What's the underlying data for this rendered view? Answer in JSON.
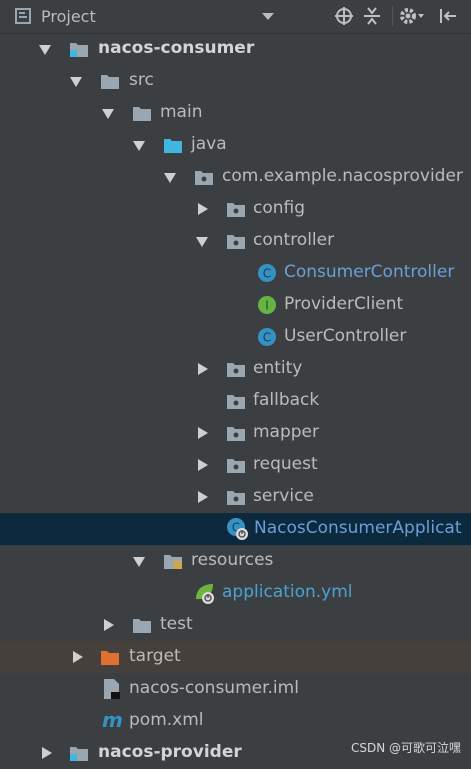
{
  "header": {
    "title": "Project",
    "icons": [
      "project-view-icon",
      "dropdown-caret-icon",
      "crosshair-locate-icon",
      "collapse-all-icon",
      "gear-icon",
      "hide-panel-icon"
    ]
  },
  "tree": [
    {
      "label": "nacos-consumer",
      "icon": "module-folder-icon",
      "expanded": true
    },
    {
      "label": "src",
      "icon": "folder-icon",
      "expanded": true
    },
    {
      "label": "main",
      "icon": "folder-icon",
      "expanded": true
    },
    {
      "label": "java",
      "icon": "source-folder-icon",
      "expanded": true
    },
    {
      "label": "com.example.nacosprovider",
      "icon": "package-icon",
      "expanded": true
    },
    {
      "label": "config",
      "icon": "package-icon",
      "expanded": false
    },
    {
      "label": "controller",
      "icon": "package-icon",
      "expanded": true
    },
    {
      "label": "ConsumerController",
      "icon": "class-icon",
      "letter": "C"
    },
    {
      "label": "ProviderClient",
      "icon": "interface-icon",
      "letter": "I"
    },
    {
      "label": "UserController",
      "icon": "class-icon",
      "letter": "C"
    },
    {
      "label": "entity",
      "icon": "package-icon",
      "expanded": false
    },
    {
      "label": "fallback",
      "icon": "package-icon"
    },
    {
      "label": "mapper",
      "icon": "package-icon",
      "expanded": false
    },
    {
      "label": "request",
      "icon": "package-icon",
      "expanded": false
    },
    {
      "label": "service",
      "icon": "package-icon",
      "expanded": false
    },
    {
      "label": "NacosConsumerApplicat",
      "icon": "spring-boot-class-icon",
      "letter": "C",
      "selected": true
    },
    {
      "label": "resources",
      "icon": "resources-folder-icon",
      "expanded": true
    },
    {
      "label": "application.yml",
      "icon": "spring-config-icon"
    },
    {
      "label": "test",
      "icon": "folder-icon",
      "expanded": false
    },
    {
      "label": "target",
      "icon": "excluded-folder-icon",
      "expanded": false
    },
    {
      "label": "nacos-consumer.iml",
      "icon": "iml-file-icon"
    },
    {
      "label": "pom.xml",
      "icon": "maven-icon",
      "letter": "m"
    },
    {
      "label": "nacos-provider",
      "icon": "module-folder-icon",
      "expanded": false
    }
  ],
  "watermark": "CSDN @可歌可泣嘿",
  "colors": {
    "background": "#3c3f41",
    "selection": "#0d293e",
    "excluded_band": "#45403b",
    "text": "#bbbbbb",
    "class_text_blue": "#6a9fd8",
    "config_text_cyan": "#4aa3d3"
  }
}
